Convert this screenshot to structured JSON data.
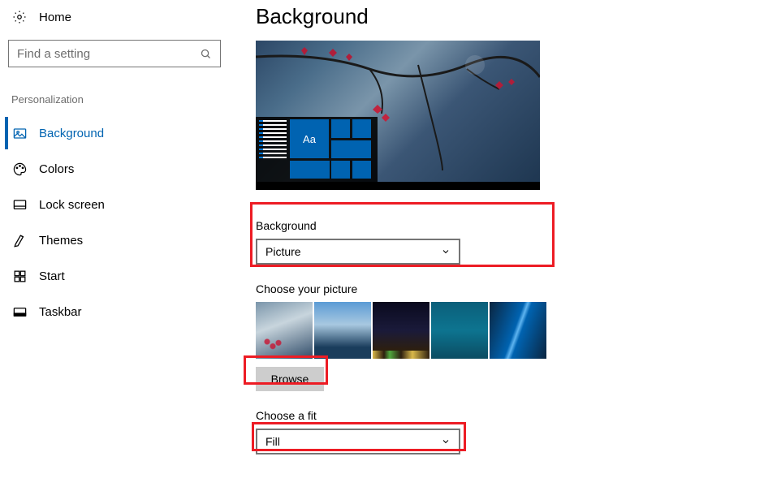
{
  "sidebar": {
    "home_label": "Home",
    "search_placeholder": "Find a setting",
    "category": "Personalization",
    "items": [
      {
        "label": "Background",
        "icon": "picture-icon",
        "active": true
      },
      {
        "label": "Colors",
        "icon": "palette-icon",
        "active": false
      },
      {
        "label": "Lock screen",
        "icon": "lock-screen-icon",
        "active": false
      },
      {
        "label": "Themes",
        "icon": "themes-icon",
        "active": false
      },
      {
        "label": "Start",
        "icon": "start-icon",
        "active": false
      },
      {
        "label": "Taskbar",
        "icon": "taskbar-icon",
        "active": false
      }
    ]
  },
  "main": {
    "title": "Background",
    "preview_sample": "Aa",
    "background_label": "Background",
    "background_value": "Picture",
    "choose_picture_label": "Choose your picture",
    "browse_label": "Browse",
    "fit_label": "Choose a fit",
    "fit_value": "Fill"
  }
}
